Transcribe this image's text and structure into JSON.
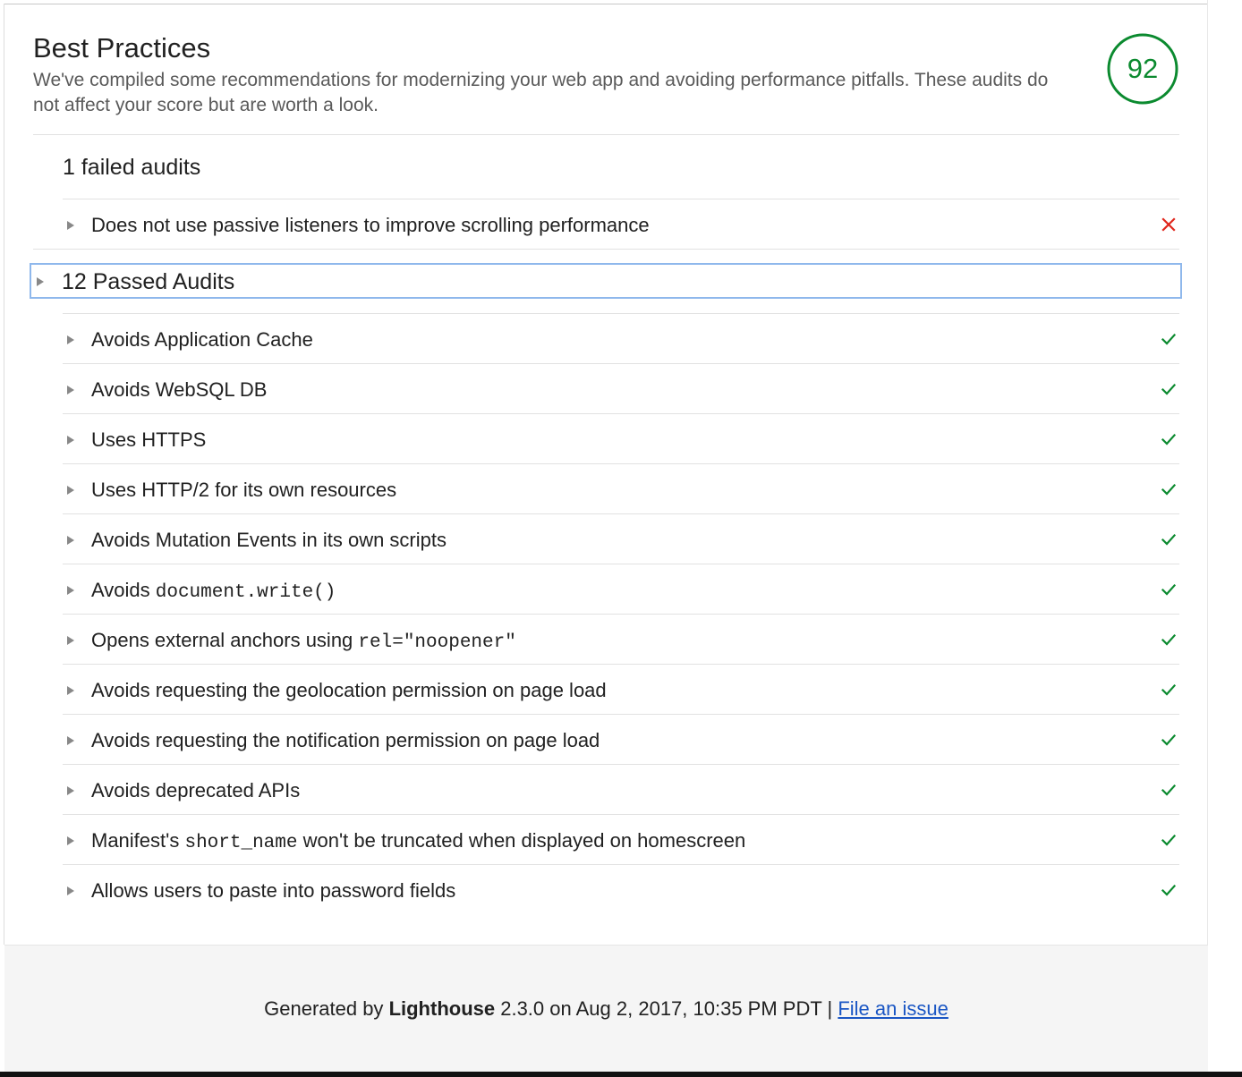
{
  "section": {
    "title": "Best Practices",
    "description": "We've compiled some recommendations for modernizing your web app and avoiding performance pitfalls. These audits do not affect your score but are worth a look.",
    "score": "92"
  },
  "failed": {
    "heading": "1 failed audits",
    "items": [
      {
        "title": "Does not use passive listeners to improve scrolling performance",
        "status": "fail"
      }
    ]
  },
  "passed": {
    "heading": "12 Passed Audits",
    "items": [
      {
        "parts": [
          {
            "text": "Avoids Application Cache"
          }
        ],
        "status": "pass"
      },
      {
        "parts": [
          {
            "text": "Avoids WebSQL DB"
          }
        ],
        "status": "pass"
      },
      {
        "parts": [
          {
            "text": "Uses HTTPS"
          }
        ],
        "status": "pass"
      },
      {
        "parts": [
          {
            "text": "Uses HTTP/2 for its own resources"
          }
        ],
        "status": "pass"
      },
      {
        "parts": [
          {
            "text": "Avoids Mutation Events in its own scripts"
          }
        ],
        "status": "pass"
      },
      {
        "parts": [
          {
            "text": "Avoids "
          },
          {
            "code": "document.write()"
          }
        ],
        "status": "pass"
      },
      {
        "parts": [
          {
            "text": "Opens external anchors using "
          },
          {
            "code": "rel=\"noopener\""
          }
        ],
        "status": "pass"
      },
      {
        "parts": [
          {
            "text": "Avoids requesting the geolocation permission on page load"
          }
        ],
        "status": "pass"
      },
      {
        "parts": [
          {
            "text": "Avoids requesting the notification permission on page load"
          }
        ],
        "status": "pass"
      },
      {
        "parts": [
          {
            "text": "Avoids deprecated APIs"
          }
        ],
        "status": "pass"
      },
      {
        "parts": [
          {
            "text": "Manifest's "
          },
          {
            "code": "short_name"
          },
          {
            "text": " won't be truncated when displayed on homescreen"
          }
        ],
        "status": "pass"
      },
      {
        "parts": [
          {
            "text": "Allows users to paste into password fields"
          }
        ],
        "status": "pass"
      }
    ]
  },
  "footer": {
    "prefix": "Generated by ",
    "product": "Lighthouse",
    "suffix": " 2.3.0 on Aug 2, 2017, 10:35 PM PDT | ",
    "link": "File an issue"
  },
  "colors": {
    "pass": "#0b8a2f",
    "fail": "#e0271d",
    "score_ring": "#0b8a2f",
    "focus_outline": "#8fb8ec"
  },
  "icons": {
    "pass": "check-icon",
    "fail": "cross-icon",
    "toggle": "triangle-right-icon"
  }
}
